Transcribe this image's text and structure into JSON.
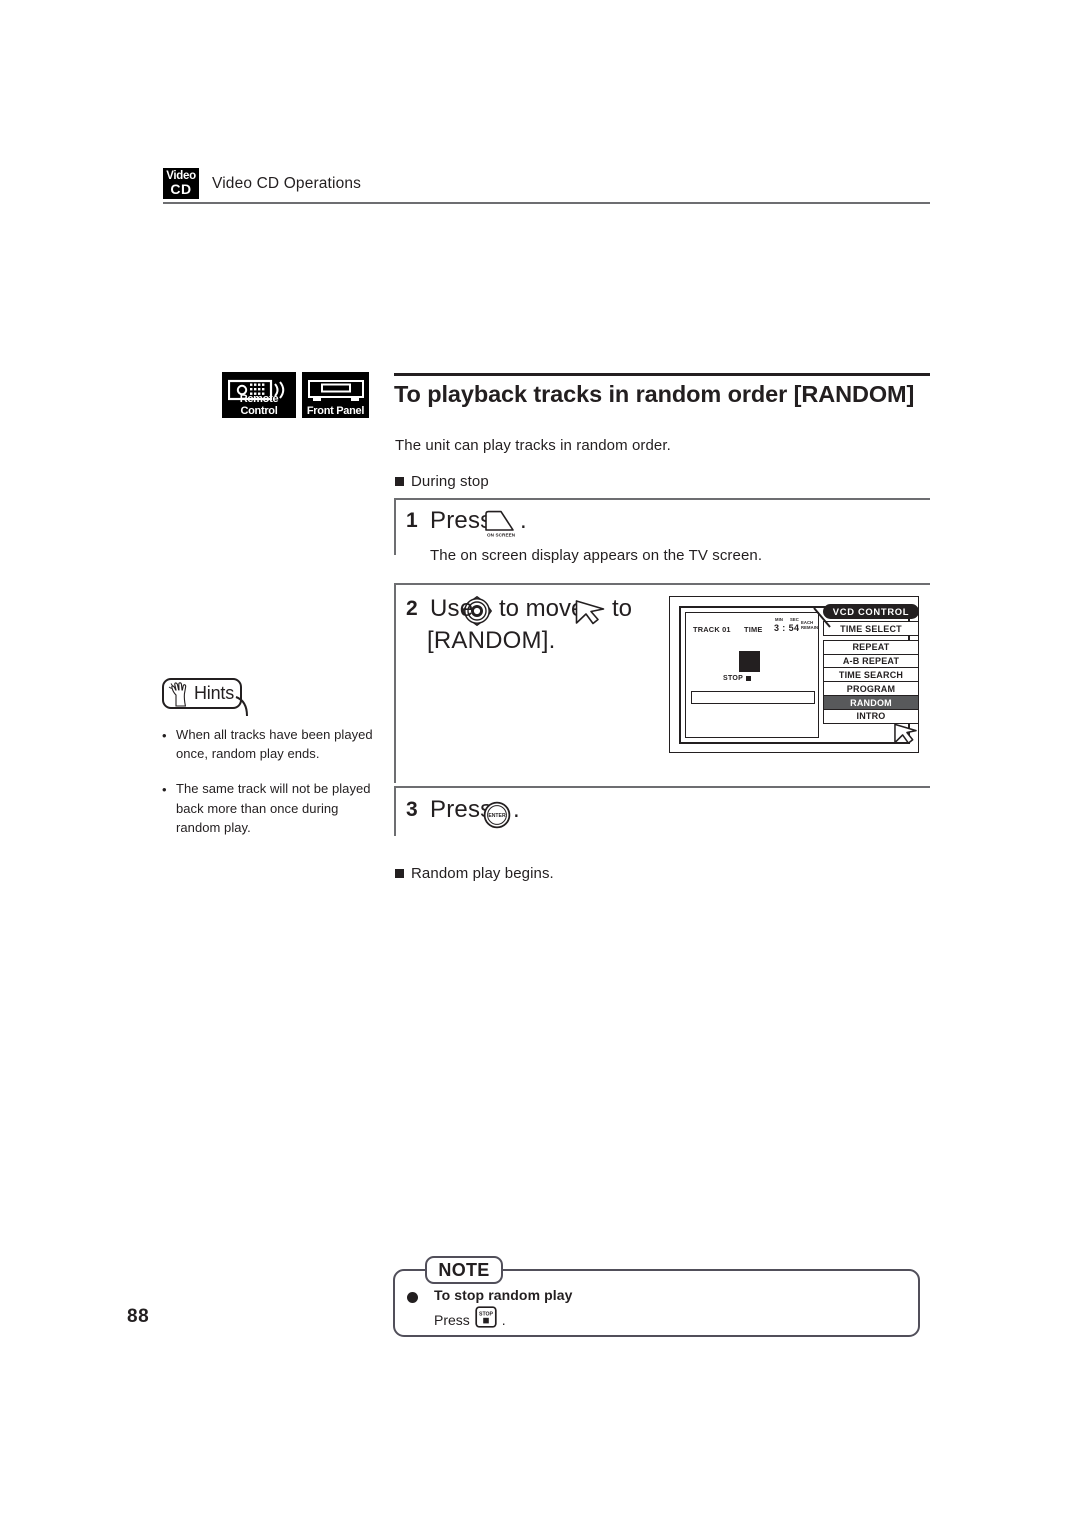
{
  "header": {
    "badge": {
      "line1": "Video",
      "line2": "CD",
      "name": "video-cd-logo"
    },
    "chapter_title": "Video CD Operations"
  },
  "section": {
    "device_badges": [
      {
        "label": "Remote Control",
        "icon": "remote-control-icon"
      },
      {
        "label": "Front Panel",
        "icon": "front-panel-icon"
      }
    ],
    "title": "To playback tracks in random order [RANDOM]",
    "intro": "The unit can play tracks in random order.",
    "condition": "During stop"
  },
  "steps": [
    {
      "number": "1",
      "verb": "Press",
      "key_label": "ON SCREEN",
      "key_icon": "on-screen-button-icon",
      "period": ".",
      "description": "The on screen display appears on the TV screen."
    },
    {
      "number": "2",
      "verb": "Use",
      "joystick_icon": "joystick-multi-control-icon",
      "mid_text": "to move",
      "cursor_icon": "cursor-arrow-icon",
      "tail_text": "to",
      "target": "[RANDOM].",
      "period": ""
    },
    {
      "number": "3",
      "verb": "Press",
      "key_label": "ENTER",
      "key_icon": "enter-button-icon",
      "period": ".",
      "result": "Random play begins."
    }
  ],
  "osd": {
    "title": "VCD CONTROL",
    "track": "TRACK 01",
    "time_word": "TIME",
    "time_value": "3 : 54",
    "min_label": "MIN",
    "sec_label": "SEC",
    "each_remain_line1": "EACH",
    "each_remain_line2": "REMAIN",
    "status": "STOP",
    "cursor_icon": "cursor-arrow-icon",
    "selected": "RANDOM",
    "menu": [
      {
        "label": "TIME SELECT",
        "selected": false,
        "gap_above": false
      },
      {
        "label": "REPEAT",
        "selected": false,
        "gap_above": true
      },
      {
        "label": "A-B REPEAT",
        "selected": false,
        "gap_above": false
      },
      {
        "label": "TIME SEARCH",
        "selected": false,
        "gap_above": false
      },
      {
        "label": "PROGRAM",
        "selected": false,
        "gap_above": false
      },
      {
        "label": "RANDOM",
        "selected": true,
        "gap_above": false
      },
      {
        "label": "INTRO",
        "selected": false,
        "gap_above": false
      }
    ],
    "colors": {
      "selected_bg": "#58595b",
      "ink": "#231f20"
    }
  },
  "hints": {
    "label": "Hints",
    "icon": "pointing-hand-icon",
    "items": [
      "When all tracks have been played once, random play ends.",
      "The same track will not be played back more than once during random play."
    ],
    "bullet": "•"
  },
  "note": {
    "label": "NOTE",
    "title": "To stop random play",
    "press_word": "Press",
    "key_label": "STOP",
    "key_icon": "stop-button-icon",
    "period": "."
  },
  "page_number": "88"
}
